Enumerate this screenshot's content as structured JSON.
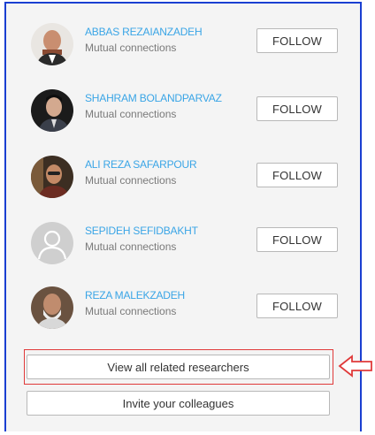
{
  "people": [
    {
      "name": "ABBAS REZAIANZADEH",
      "subtitle": "Mutual connections",
      "follow_label": "FOLLOW",
      "avatar": "photo"
    },
    {
      "name": "SHAHRAM BOLANDPARVAZ",
      "subtitle": "Mutual connections",
      "follow_label": "FOLLOW",
      "avatar": "photo"
    },
    {
      "name": "ALI REZA SAFARPOUR",
      "subtitle": "Mutual connections",
      "follow_label": "FOLLOW",
      "avatar": "photo"
    },
    {
      "name": "SEPIDEH SEFIDBAKHT",
      "subtitle": "Mutual connections",
      "follow_label": "FOLLOW",
      "avatar": "default-user-icon"
    },
    {
      "name": "REZA MALEKZADEH",
      "subtitle": "Mutual connections",
      "follow_label": "FOLLOW",
      "avatar": "photo"
    }
  ],
  "actions": {
    "view_all": "View all related researchers",
    "invite": "Invite your colleagues"
  },
  "colors": {
    "name_link": "#3aa5e6",
    "highlight": "#e03a3a",
    "frame": "#1a3fd1"
  }
}
